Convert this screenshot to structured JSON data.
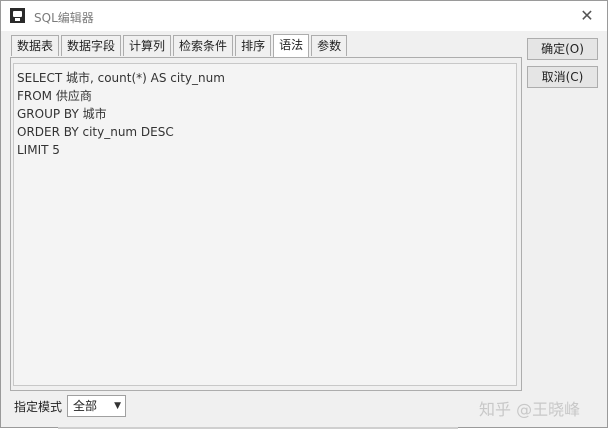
{
  "window": {
    "title": "SQL编辑器",
    "close_glyph": "✕"
  },
  "tabs": [
    {
      "label": "数据表",
      "active": false
    },
    {
      "label": "数据字段",
      "active": false
    },
    {
      "label": "计算列",
      "active": false
    },
    {
      "label": "检索条件",
      "active": false
    },
    {
      "label": "排序",
      "active": false
    },
    {
      "label": "语法",
      "active": true
    },
    {
      "label": "参数",
      "active": false
    }
  ],
  "editor": {
    "lines": [
      "SELECT 城市, count(*) AS city_num",
      "FROM 供应商",
      "GROUP BY 城市",
      "ORDER BY city_num DESC",
      "LIMIT 5"
    ]
  },
  "buttons": {
    "ok_label": "确定(O)",
    "cancel_label": "取消(C)"
  },
  "mode": {
    "label": "指定模式",
    "selected": "全部"
  },
  "watermark": "知乎 @王晓峰"
}
